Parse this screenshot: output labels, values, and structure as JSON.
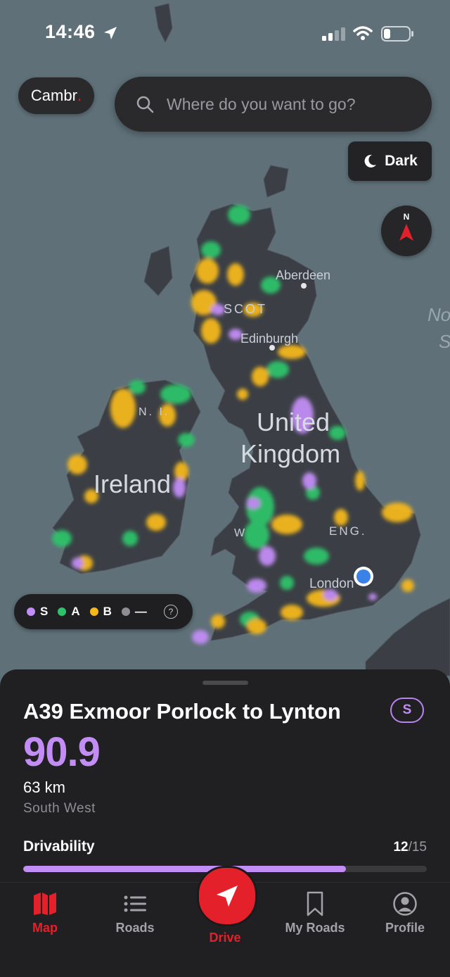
{
  "status_bar": {
    "time": "14:46"
  },
  "brand": {
    "name": "Cambr",
    "suffix": "."
  },
  "search": {
    "placeholder": "Where do you want to go?"
  },
  "theme_toggle": {
    "label": "Dark"
  },
  "compass": {
    "label": "N"
  },
  "map_labels": {
    "aberdeen": "Aberdeen",
    "scotland": "SCOT",
    "edinburgh": "Edinburgh",
    "united": "United",
    "kingdom": "Kingdom",
    "ni": "N. I.",
    "ireland": "Ireland",
    "wales": "W",
    "england": "ENG.",
    "london": "London",
    "north_sea_1": "No",
    "north_sea_2": "S"
  },
  "legend": {
    "items": [
      {
        "label": "S",
        "color": "#c28df5"
      },
      {
        "label": "A",
        "color": "#2ec26a"
      },
      {
        "label": "B",
        "color": "#f4b81c"
      },
      {
        "label": "—",
        "color": "#8e8e93"
      }
    ],
    "help": "?"
  },
  "road": {
    "name": "A39 Exmoor Porlock to Lynton",
    "tier": "S",
    "score": "90.9",
    "distance": "63 km",
    "region": "South West",
    "drivability_label": "Drivability",
    "drivability_value": "12",
    "drivability_max": "/15",
    "drivability_fraction": 0.8
  },
  "tabs": {
    "map": "Map",
    "roads": "Roads",
    "drive": "Drive",
    "my_roads": "My Roads",
    "profile": "Profile"
  },
  "colors": {
    "accent": "#e4202b",
    "tier_s": "#c28df5",
    "tier_a": "#2ec26a",
    "tier_b": "#f4b81c",
    "sea": "#5f7078",
    "land": "#3b3f45"
  }
}
